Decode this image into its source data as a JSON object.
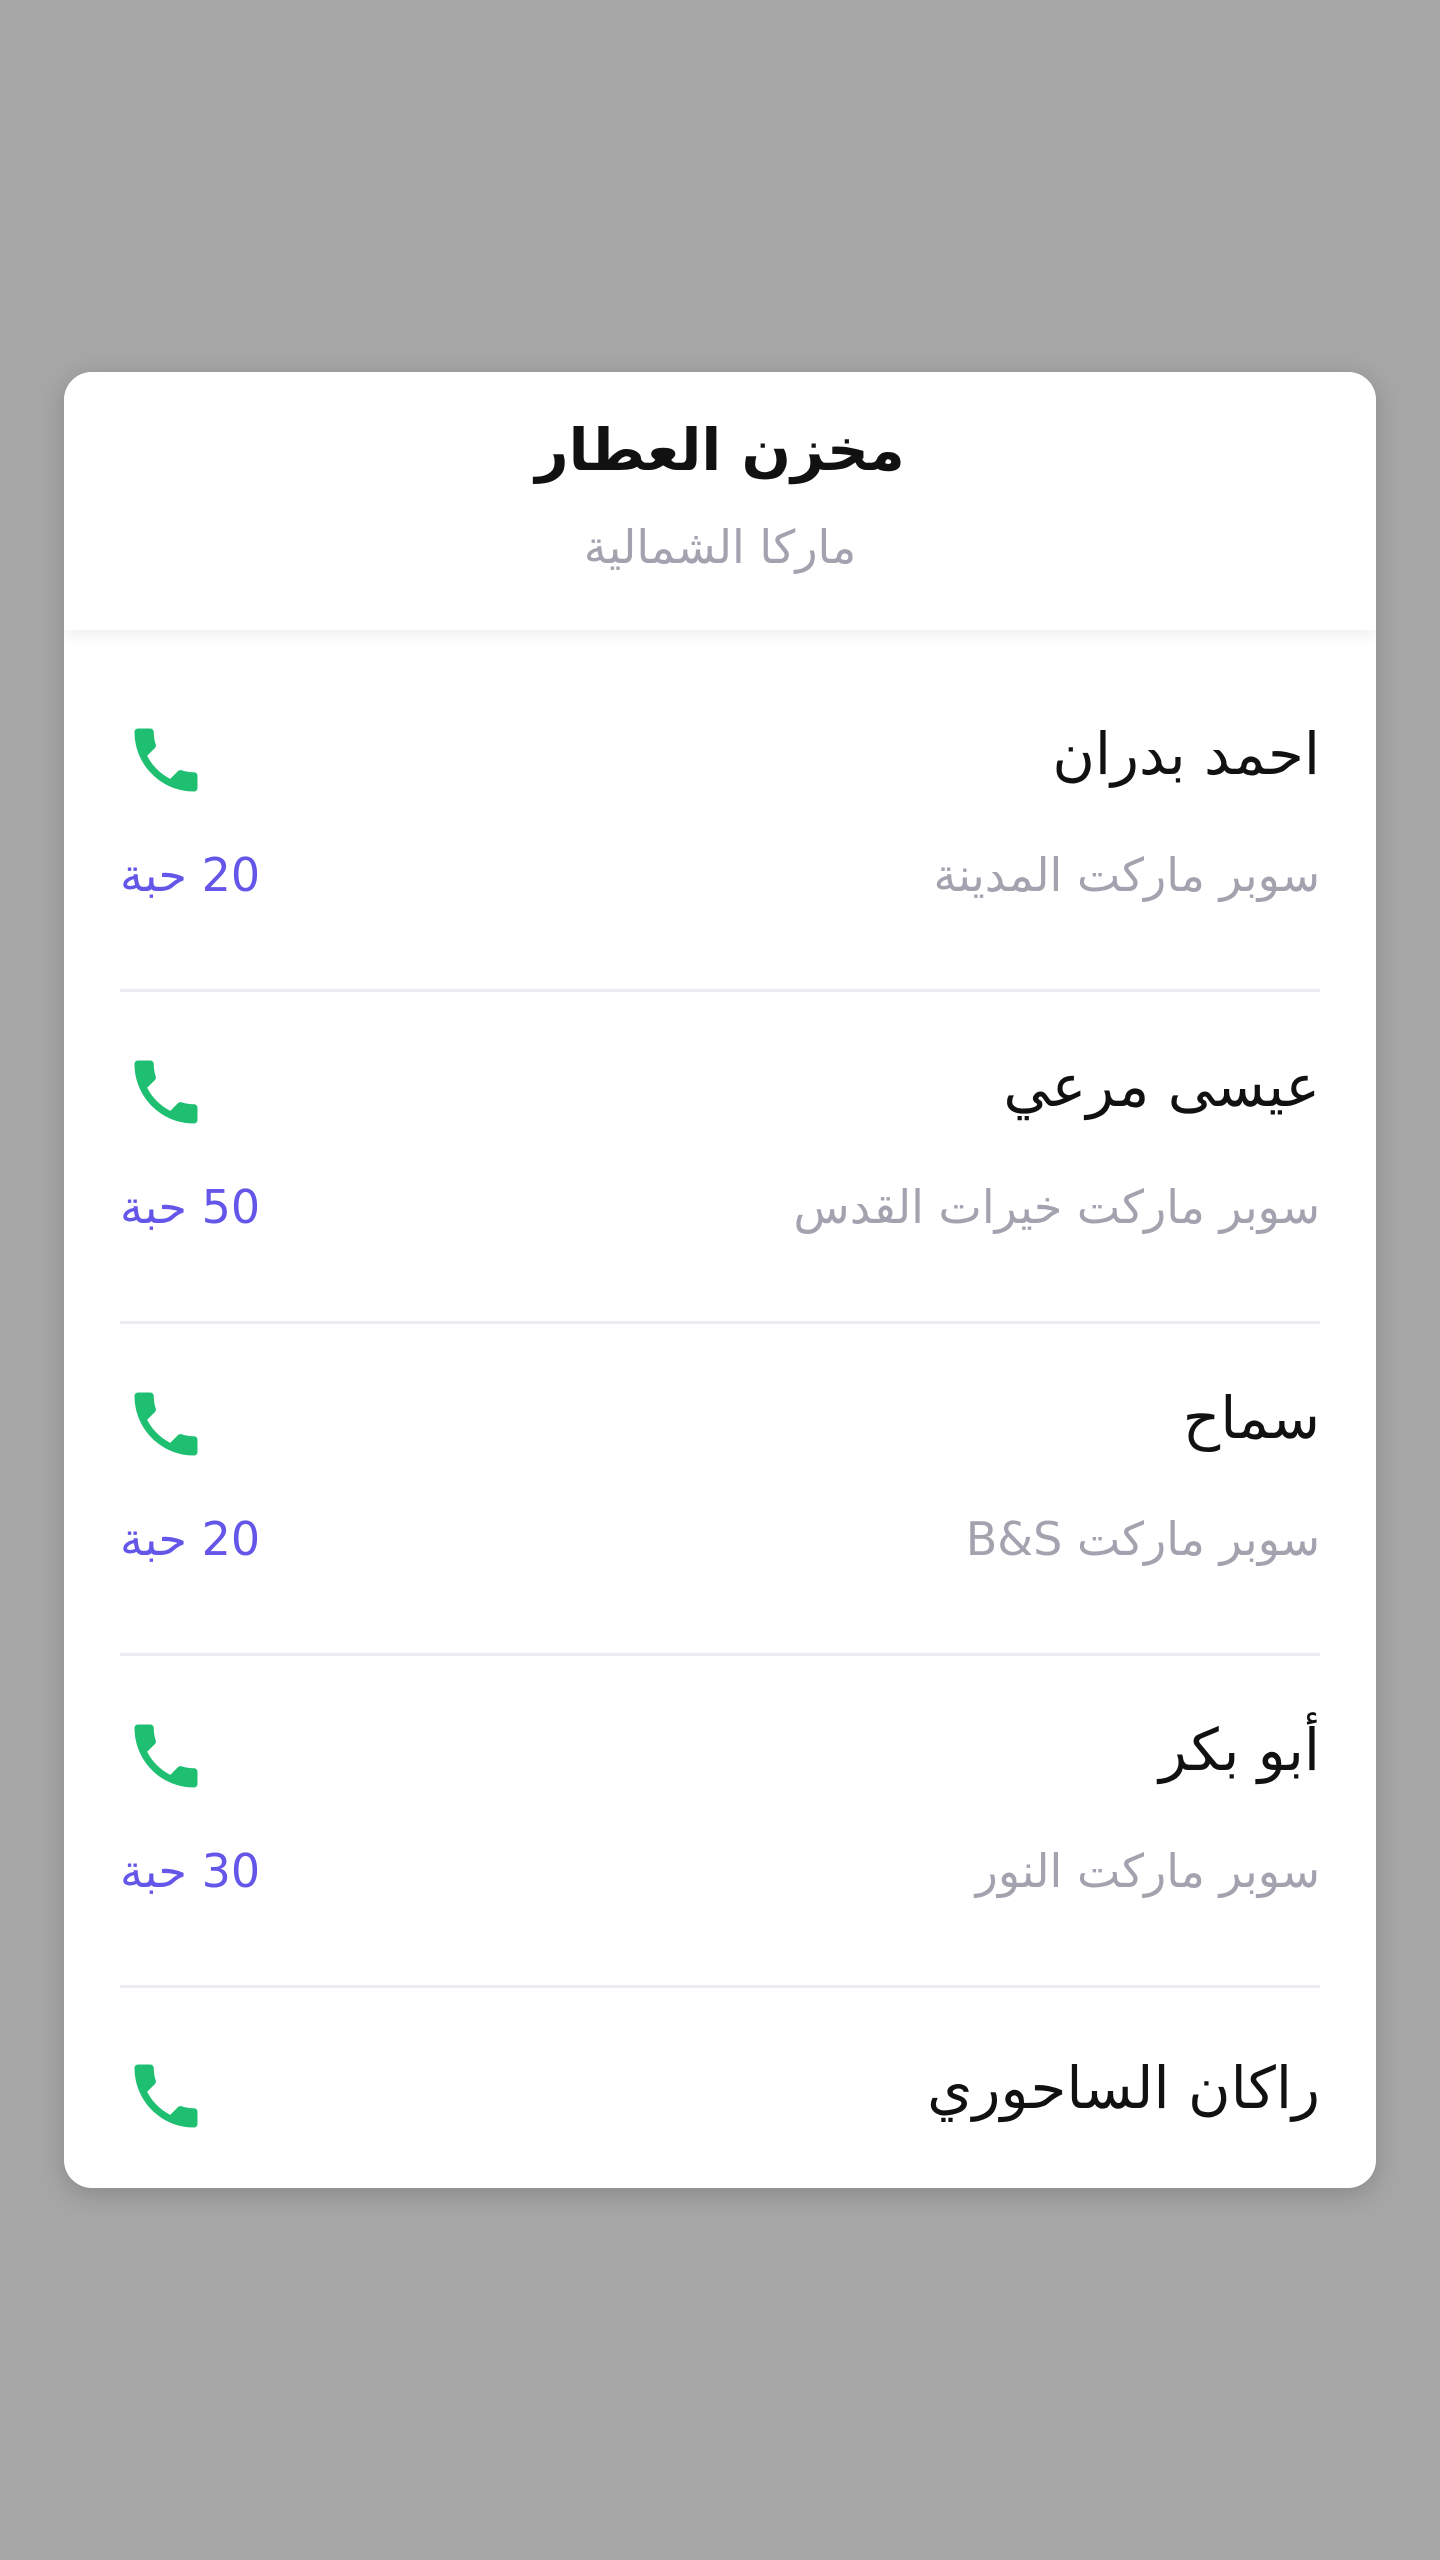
{
  "dialog": {
    "title": "مخزن العطار",
    "subtitle": "ماركا الشمالية"
  },
  "contacts": [
    {
      "name": "احمد بدران",
      "store": "سوبر ماركت المدينة",
      "quantity": "20 حبة",
      "icon": "phone-icon"
    },
    {
      "name": "عيسى مرعي",
      "store": "سوبر ماركت خيرات القدس",
      "quantity": "50 حبة",
      "icon": "phone-icon"
    },
    {
      "name": "سماح",
      "store": "سوبر ماركت B&S",
      "quantity": "20 حبة",
      "icon": "phone-icon"
    },
    {
      "name": "أبو بكر",
      "store": "سوبر ماركت النور",
      "quantity": "30 حبة",
      "icon": "phone-icon"
    },
    {
      "name": "راكان الساحوري",
      "icon": "phone-icon"
    }
  ],
  "colors": {
    "overlay": "#a6a6a6",
    "phone": "#1fbf71",
    "quantity": "#6356e8",
    "secondary_text": "#a3a3b0"
  }
}
